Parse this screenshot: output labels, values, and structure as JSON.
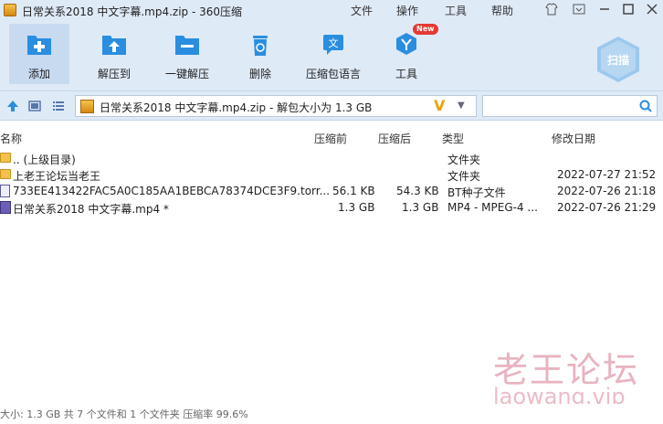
{
  "window": {
    "title": "日常关系2018 中文字幕.mp4.zip - 360压缩"
  },
  "menu": [
    "文件",
    "操作",
    "工具",
    "帮助"
  ],
  "toolbar": {
    "buttons": [
      {
        "label": "添加",
        "icon": "add-icon"
      },
      {
        "label": "解压到",
        "icon": "extract-to-icon"
      },
      {
        "label": "一键解压",
        "icon": "one-click-extract-icon"
      },
      {
        "label": "删除",
        "icon": "delete-icon"
      },
      {
        "label": "压缩包语言",
        "icon": "language-icon"
      },
      {
        "label": "工具",
        "icon": "tools-icon"
      }
    ],
    "new_badge": "New",
    "scan_label": "扫描"
  },
  "path": {
    "text": "日常关系2018 中文字幕.mp4.zip - 解包大小为 1.3 GB",
    "v_label": "V"
  },
  "columns": [
    "名称",
    "压缩前",
    "压缩后",
    "类型",
    "修改日期"
  ],
  "files": [
    {
      "name": ".. (上级目录)",
      "before": "",
      "after": "",
      "type": "文件夹",
      "date": "",
      "icon": "folder"
    },
    {
      "name": "上老王论坛当老王",
      "before": "",
      "after": "",
      "type": "文件夹",
      "date": "2022-07-27 21:52",
      "icon": "folder"
    },
    {
      "name": "733EE413422FAC5A0C185AA1BEBCA78374DCE3F9.torr...",
      "before": "56.1 KB",
      "after": "54.3 KB",
      "type": "BT种子文件",
      "date": "2022-07-26 21:18",
      "icon": "file"
    },
    {
      "name": "日常关系2018 中文字幕.mp4 *",
      "before": "1.3 GB",
      "after": "1.3 GB",
      "type": "MP4 - MPEG-4 ...",
      "date": "2022-07-26 21:29",
      "icon": "video"
    }
  ],
  "status": {
    "text": "大小: 1.3 GB 共 7 个文件和 1 个文件夹 压缩率 99.6%"
  },
  "watermark": {
    "line1": "老王论坛",
    "line2": "laowang.vip"
  }
}
